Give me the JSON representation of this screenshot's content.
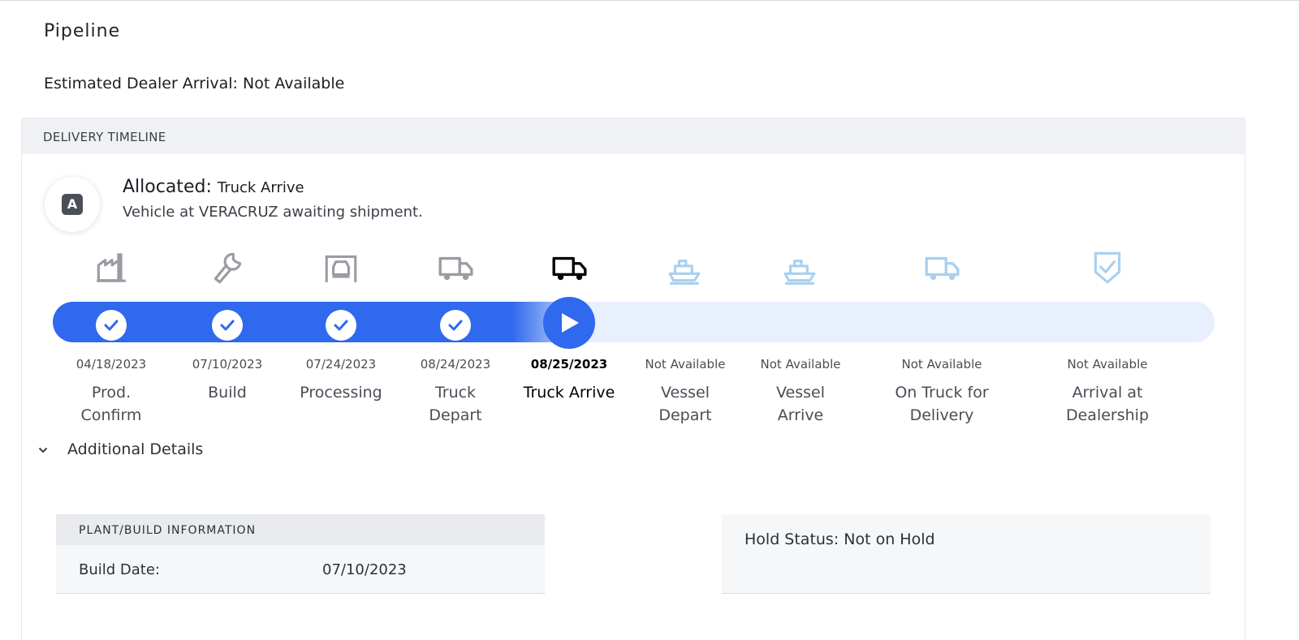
{
  "page": {
    "title": "Pipeline",
    "estimated_arrival": "Estimated Dealer Arrival: Not Available"
  },
  "timeline": {
    "header": "DELIVERY TIMELINE",
    "status": {
      "badge": "A",
      "label": "Allocated:",
      "stage": "Truck Arrive",
      "description": "Vehicle at VERACRUZ awaiting shipment."
    },
    "progress_fraction": 0.46,
    "stages": [
      {
        "label": "Prod.\nConfirm",
        "date": "04/18/2023",
        "state": "complete",
        "icon": "factory-icon"
      },
      {
        "label": "Build",
        "date": "07/10/2023",
        "state": "complete",
        "icon": "wrench-icon"
      },
      {
        "label": "Processing",
        "date": "07/24/2023",
        "state": "complete",
        "icon": "car-garage-icon"
      },
      {
        "label": "Truck\nDepart",
        "date": "08/24/2023",
        "state": "complete",
        "icon": "truck-icon"
      },
      {
        "label": "Truck Arrive",
        "date": "08/25/2023",
        "state": "current",
        "icon": "truck-icon"
      },
      {
        "label": "Vessel\nDepart",
        "date": "Not Available",
        "state": "pending",
        "icon": "ship-icon"
      },
      {
        "label": "Vessel\nArrive",
        "date": "Not Available",
        "state": "pending",
        "icon": "ship-icon"
      },
      {
        "label": "On Truck for\nDelivery",
        "date": "Not Available",
        "state": "pending",
        "icon": "truck-icon"
      },
      {
        "label": "Arrival at\nDealership",
        "date": "Not Available",
        "state": "pending",
        "icon": "shield-check-icon"
      }
    ]
  },
  "details": {
    "toggle_label": "Additional Details",
    "plant": {
      "header": "PLANT/BUILD INFORMATION",
      "build_date_label": "Build Date:",
      "build_date_value": "07/10/2023"
    },
    "hold_status": "Hold Status: Not on Hold"
  },
  "colors": {
    "accent": "#2e69ee",
    "track_background": "#e8effd",
    "complete_icon": "#9a9ca3",
    "current_icon": "#000000",
    "pending_icon": "#a9d0ee"
  }
}
